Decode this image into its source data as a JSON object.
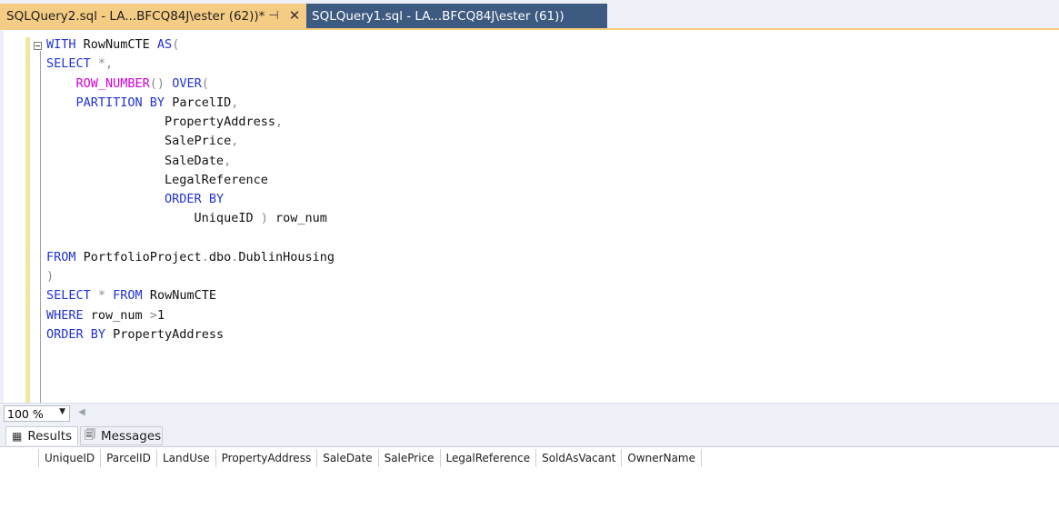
{
  "tabs": [
    {
      "label": "SQLQuery2.sql - LA...BFCQ84J\\ester (62))*",
      "active": true
    },
    {
      "label": "SQLQuery1.sql - LA...BFCQ84J\\ester (61))",
      "active": false
    }
  ],
  "icons": {
    "pin": "pin-icon",
    "close": "close-icon"
  },
  "editor": {
    "lines": [
      [
        [
          "kw",
          "WITH"
        ],
        [
          "t",
          " RowNumCTE "
        ],
        [
          "kw",
          "AS"
        ],
        [
          "op",
          "("
        ]
      ],
      [
        [
          "kw",
          "SELECT"
        ],
        [
          "op",
          " *,"
        ]
      ],
      [
        [
          "t",
          "    "
        ],
        [
          "fn",
          "ROW_NUMBER"
        ],
        [
          "op",
          "()"
        ],
        [
          "t",
          " "
        ],
        [
          "kw",
          "OVER"
        ],
        [
          "op",
          "("
        ]
      ],
      [
        [
          "t",
          "    "
        ],
        [
          "kw",
          "PARTITION BY"
        ],
        [
          "t",
          " ParcelID"
        ],
        [
          "op",
          ","
        ]
      ],
      [
        [
          "t",
          "                PropertyAddress"
        ],
        [
          "op",
          ","
        ]
      ],
      [
        [
          "t",
          "                SalePrice"
        ],
        [
          "op",
          ","
        ]
      ],
      [
        [
          "t",
          "                SaleDate"
        ],
        [
          "op",
          ","
        ]
      ],
      [
        [
          "t",
          "                LegalReference"
        ]
      ],
      [
        [
          "t",
          "                "
        ],
        [
          "kw",
          "ORDER BY"
        ]
      ],
      [
        [
          "t",
          "                    UniqueID "
        ],
        [
          "op",
          ")"
        ],
        [
          "t",
          " row_num"
        ]
      ],
      [
        [
          "t",
          ""
        ]
      ],
      [
        [
          "kw",
          "FROM"
        ],
        [
          "t",
          " PortfolioProject"
        ],
        [
          "op",
          "."
        ],
        [
          "t",
          "dbo"
        ],
        [
          "op",
          "."
        ],
        [
          "t",
          "DublinHousing"
        ]
      ],
      [
        [
          "op",
          ")"
        ]
      ],
      [
        [
          "kw",
          "SELECT"
        ],
        [
          "op",
          " * "
        ],
        [
          "kw",
          "FROM"
        ],
        [
          "t",
          " RowNumCTE"
        ]
      ],
      [
        [
          "kw",
          "WHERE"
        ],
        [
          "t",
          " row_num "
        ],
        [
          "op",
          ">"
        ],
        [
          "t",
          "1"
        ]
      ],
      [
        [
          "kw",
          "ORDER BY"
        ],
        [
          "t",
          " PropertyAddress"
        ]
      ]
    ]
  },
  "zoom": {
    "value": "100 %"
  },
  "results": {
    "tabs": [
      {
        "label": "Results",
        "icon": "grid-icon"
      },
      {
        "label": "Messages",
        "icon": "messages-icon"
      }
    ],
    "columns": [
      "UniqueID",
      "ParcelID",
      "LandUse",
      "PropertyAddress",
      "SaleDate",
      "SalePrice",
      "LegalReference",
      "SoldAsVacant",
      "OwnerName"
    ]
  },
  "colors": {
    "active_tab": "#f5cc84",
    "inactive_tab": "#3d5a80",
    "keyword": "#1f33d6",
    "function": "#d100d1",
    "operator": "#8a8a8a"
  }
}
